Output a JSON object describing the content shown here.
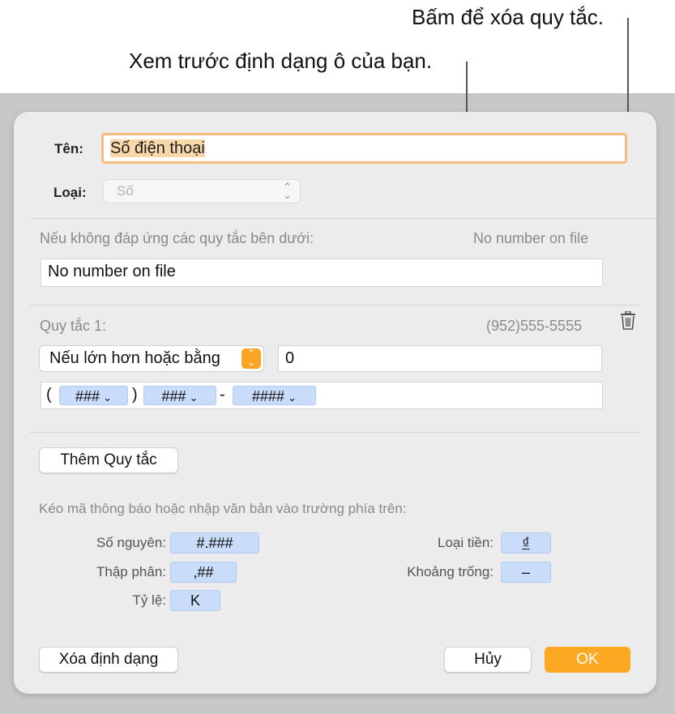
{
  "callouts": {
    "delete_rule": "Bấm để xóa quy tắc.",
    "preview_format": "Xem trước định dạng ô của bạn."
  },
  "form": {
    "name_label": "Tên:",
    "name_value": "Số điện thoại",
    "type_label": "Loại:",
    "type_value": "Số"
  },
  "fallback": {
    "label": "Nếu không đáp ứng các quy tắc bên dưới:",
    "preview": "No number on file",
    "value": "No number on file"
  },
  "rule1": {
    "title": "Quy tắc 1:",
    "preview": "(952)555-5555",
    "condition": "Nếu lớn hơn hoặc bằng",
    "condition_value": "0",
    "pattern": {
      "open_paren": "(",
      "token1": "###",
      "close_paren": ")",
      "token2": "###",
      "dash": "-",
      "token3": "####"
    }
  },
  "add_rule_label": "Thêm Quy tắc",
  "hint": "Kéo mã thông báo hoặc nhập văn bản vào trường phía trên:",
  "tokens": {
    "integer_label": "Số nguyên:",
    "integer_value": "#.###",
    "decimal_label": "Thập phân:",
    "decimal_value": ",##",
    "scale_label": "Tỷ lệ:",
    "scale_value": "K",
    "currency_label": "Loại tiền:",
    "currency_value": "₫",
    "space_label": "Khoảng trống:",
    "space_value": "–"
  },
  "buttons": {
    "clear_format": "Xóa định dạng",
    "cancel": "Hủy",
    "ok": "OK"
  },
  "colors": {
    "accent": "#fda823",
    "token": "#c9dcf9",
    "focus_ring": "#f7bd7e"
  }
}
